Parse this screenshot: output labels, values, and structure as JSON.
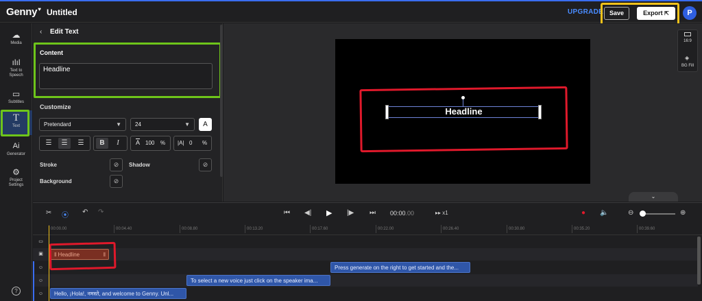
{
  "header": {
    "logo": "Genny",
    "title": "Untitled",
    "upgrade": "UPGRADE",
    "save_label": "Save",
    "export_label": "Export",
    "avatar_initial": "P"
  },
  "sidebar": {
    "items": [
      {
        "label": "Media",
        "icon": "cloud-upload-icon"
      },
      {
        "label": "Text to Speech",
        "icon": "waveform-icon"
      },
      {
        "label": "Subtitles",
        "icon": "subtitles-icon"
      },
      {
        "label": "Text",
        "icon": "text-T-icon",
        "active": true
      },
      {
        "label": "Generator",
        "icon": "ai-icon"
      },
      {
        "label": "Project Settings",
        "icon": "gear-icon"
      }
    ],
    "help": "?"
  },
  "panel": {
    "back": "‹",
    "title": "Edit Text",
    "content_label": "Content",
    "content_value": "Headline",
    "customize_label": "Customize",
    "font_family": "Pretendard",
    "font_size": "24",
    "color_button": "A",
    "align": [
      "left",
      "center",
      "right"
    ],
    "bold": "B",
    "italic": "I",
    "scale_icon": "A",
    "scale_value": "100",
    "scale_unit": "%",
    "spacing_icon": "|A|",
    "spacing_value": "0",
    "spacing_unit": "%",
    "stroke_label": "Stroke",
    "shadow_label": "Shadow",
    "background_label": "Background"
  },
  "stage": {
    "canvas_text": "Headline",
    "ratio_label": "16:9",
    "bg_fill_label": "BG Fill"
  },
  "timeline": {
    "timecode_main": "00:00",
    "timecode_frac": ".00",
    "speed": "x1",
    "ruler": [
      "00:00.00",
      "00:04.40",
      "00:08.80",
      "00:13.20",
      "00:17.60",
      "00:22.00",
      "00:26.40",
      "00:30.80",
      "00:35.20",
      "00:39.60"
    ],
    "clips": {
      "text_clip": "Headline",
      "voice_1": "Press generate on the right to get started and the...",
      "voice_2": "To select a new voice just click on the speaker ima...",
      "voice_3": "Hello, ¡Hola!, नमस्ते, and welcome to Genny. Unl..."
    }
  },
  "colors": {
    "accent": "#3a6df0",
    "highlight_yellow": "#f2c21b",
    "highlight_green": "#6ec51a",
    "highlight_red": "#e0192b"
  }
}
